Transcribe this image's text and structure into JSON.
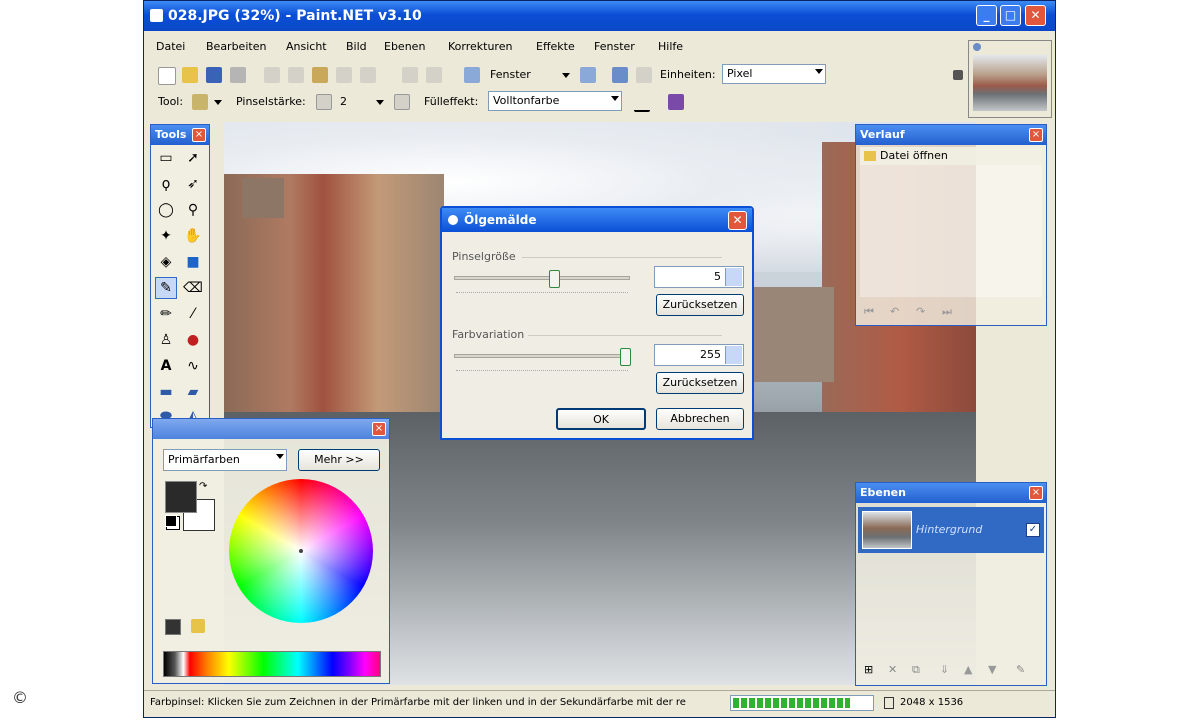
{
  "window": {
    "title": "028.JPG (32%) - Paint.NET v3.10",
    "controls": {
      "minimize": "_",
      "maximize": "□",
      "close": "✕"
    }
  },
  "menu": [
    "Datei",
    "Bearbeiten",
    "Ansicht",
    "Bild",
    "Ebenen",
    "Korrekturen",
    "Effekte",
    "Fenster",
    "Hilfe"
  ],
  "toolbar": {
    "window_label": "Fenster",
    "units_label": "Einheiten:",
    "units_value": "Pixel"
  },
  "toolbar2": {
    "tool_label": "Tool:",
    "brush_width_label": "Pinselstärke:",
    "brush_width_value": "2",
    "fill_label": "Fülleffekt:",
    "fill_value": "Volltonfarbe"
  },
  "tools_panel": {
    "title": "Tools"
  },
  "history_panel": {
    "title": "Verlauf",
    "items": [
      "Datei öffnen"
    ]
  },
  "layers_panel": {
    "title": "Ebenen",
    "layer_name": "Hintergrund"
  },
  "colors_panel": {
    "palette_select": "Primärfarben",
    "more_button": "Mehr >>"
  },
  "dialog": {
    "title": "Ölgemälde",
    "brush_size_label": "Pinselgröße",
    "brush_size_value": "5",
    "brush_size_fraction": 0.55,
    "coarseness_label": "Farbvariation",
    "coarseness_value": "255",
    "coarseness_fraction": 1.0,
    "reset_label": "Zurücksetzen",
    "ok_label": "OK",
    "cancel_label": "Abbrechen"
  },
  "statusbar": {
    "hint": "Farbpinsel: Klicken Sie zum Zeichnen in der Primärfarbe mit der linken und in der Sekundärfarbe mit der re",
    "progress_fraction": 0.85,
    "image_size": "2048 x 1536"
  },
  "copyright": "©",
  "colors": {
    "titlebar": "#0b4fd6",
    "panel_title": "#2360cf",
    "close_red": "#e0573c",
    "progress_green": "#2fb22f"
  }
}
